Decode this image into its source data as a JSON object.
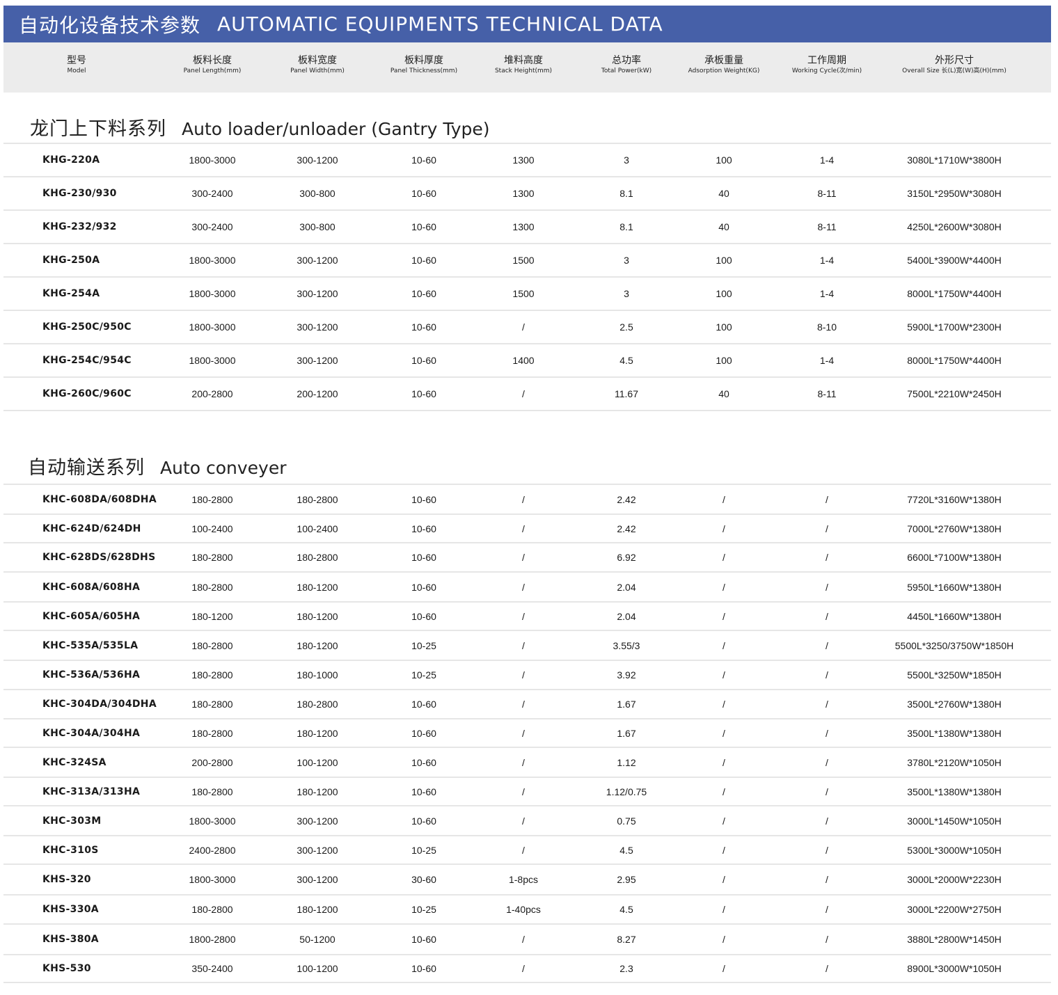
{
  "banner": {
    "title_zh": "自动化设备技术参数",
    "title_en": "AUTOMATIC EQUIPMENTS  TECHNICAL DATA"
  },
  "columns": [
    {
      "zh": "型号",
      "en": "Model"
    },
    {
      "zh": "板料长度",
      "en": "Panel Length(mm)"
    },
    {
      "zh": "板料宽度",
      "en": "Panel Width(mm)"
    },
    {
      "zh": "板料厚度",
      "en": "Panel Thickness(mm)"
    },
    {
      "zh": "堆料高度",
      "en": "Stack Height(mm)"
    },
    {
      "zh": "总功率",
      "en": "Total Power(kW)"
    },
    {
      "zh": "承板重量",
      "en": "Adsorption Weight(KG)"
    },
    {
      "zh": "工作周期",
      "en": "Working Cycle(次/min)"
    },
    {
      "zh": "外形尺寸",
      "en": "Overall Size 长(L)宽(W)高(H)(mm)"
    }
  ],
  "sections": [
    {
      "title_zh": "龙门上下料系列",
      "title_en": "Auto loader/unloader (Gantry Type)",
      "rows": [
        [
          "KHG-220A",
          "1800-3000",
          "300-1200",
          "10-60",
          "1300",
          "3",
          "100",
          "1-4",
          "3080L*1710W*3800H"
        ],
        [
          "KHG-230/930",
          "300-2400",
          "300-800",
          "10-60",
          "1300",
          "8.1",
          "40",
          "8-11",
          "3150L*2950W*3080H"
        ],
        [
          "KHG-232/932",
          "300-2400",
          "300-800",
          "10-60",
          "1300",
          "8.1",
          "40",
          "8-11",
          "4250L*2600W*3080H"
        ],
        [
          "KHG-250A",
          "1800-3000",
          "300-1200",
          "10-60",
          "1500",
          "3",
          "100",
          "1-4",
          "5400L*3900W*4400H"
        ],
        [
          "KHG-254A",
          "1800-3000",
          "300-1200",
          "10-60",
          "1500",
          "3",
          "100",
          "1-4",
          "8000L*1750W*4400H"
        ],
        [
          "KHG-250C/950C",
          "1800-3000",
          "300-1200",
          "10-60",
          "/",
          "2.5",
          "100",
          "8-10",
          "5900L*1700W*2300H"
        ],
        [
          "KHG-254C/954C",
          "1800-3000",
          "300-1200",
          "10-60",
          "1400",
          "4.5",
          "100",
          "1-4",
          "8000L*1750W*4400H"
        ],
        [
          "KHG-260C/960C",
          "200-2800",
          "200-1200",
          "10-60",
          "/",
          "11.67",
          "40",
          "8-11",
          "7500L*2210W*2450H"
        ]
      ]
    },
    {
      "title_zh": "自动输送系列",
      "title_en": "Auto conveyer",
      "rows": [
        [
          "KHC-608DA/608DHA",
          "180-2800",
          "180-2800",
          "10-60",
          "/",
          "2.42",
          "/",
          "/",
          "7720L*3160W*1380H"
        ],
        [
          "KHC-624D/624DH",
          "100-2400",
          "100-2400",
          "10-60",
          "/",
          "2.42",
          "/",
          "/",
          "7000L*2760W*1380H"
        ],
        [
          "KHC-628DS/628DHS",
          "180-2800",
          "180-2800",
          "10-60",
          "/",
          "6.92",
          "/",
          "/",
          "6600L*7100W*1380H"
        ],
        [
          "KHC-608A/608HA",
          "180-2800",
          "180-1200",
          "10-60",
          "/",
          "2.04",
          "/",
          "/",
          "5950L*1660W*1380H"
        ],
        [
          "KHC-605A/605HA",
          "180-1200",
          "180-1200",
          "10-60",
          "/",
          "2.04",
          "/",
          "/",
          "4450L*1660W*1380H"
        ],
        [
          "KHC-535A/535LA",
          "180-2800",
          "180-1200",
          "10-25",
          "/",
          "3.55/3",
          "/",
          "/",
          "5500L*3250/3750W*1850H"
        ],
        [
          "KHC-536A/536HA",
          "180-2800",
          "180-1000",
          "10-25",
          "/",
          "3.92",
          "/",
          "/",
          "5500L*3250W*1850H"
        ],
        [
          "KHC-304DA/304DHA",
          "180-2800",
          "180-2800",
          "10-60",
          "/",
          "1.67",
          "/",
          "/",
          "3500L*2760W*1380H"
        ],
        [
          "KHC-304A/304HA",
          "180-2800",
          "180-1200",
          "10-60",
          "/",
          "1.67",
          "/",
          "/",
          "3500L*1380W*1380H"
        ],
        [
          "KHC-324SA",
          "200-2800",
          "100-1200",
          "10-60",
          "/",
          "1.12",
          "/",
          "/",
          "3780L*2120W*1050H"
        ],
        [
          "KHC-313A/313HA",
          "180-2800",
          "180-1200",
          "10-60",
          "/",
          "1.12/0.75",
          "/",
          "/",
          "3500L*1380W*1380H"
        ],
        [
          "KHC-303M",
          "1800-3000",
          "300-1200",
          "10-60",
          "/",
          "0.75",
          "/",
          "/",
          "3000L*1450W*1050H"
        ],
        [
          "KHC-310S",
          "2400-2800",
          "300-1200",
          "10-25",
          "/",
          "4.5",
          "/",
          "/",
          "5300L*3000W*1050H"
        ],
        [
          "KHS-320",
          "1800-3000",
          "300-1200",
          "30-60",
          "1-8pcs",
          "2.95",
          "/",
          "/",
          "3000L*2000W*2230H"
        ],
        [
          "KHS-330A",
          "180-2800",
          "180-1200",
          "10-25",
          "1-40pcs",
          "4.5",
          "/",
          "/",
          "3000L*2200W*2750H"
        ],
        [
          "KHS-380A",
          "1800-2800",
          "50-1200",
          "10-60",
          "/",
          "8.27",
          "/",
          "/",
          "3880L*2800W*1450H"
        ],
        [
          "KHS-530",
          "350-2400",
          "100-1200",
          "10-60",
          "/",
          "2.3",
          "/",
          "/",
          "8900L*3000W*1050H"
        ]
      ]
    }
  ]
}
